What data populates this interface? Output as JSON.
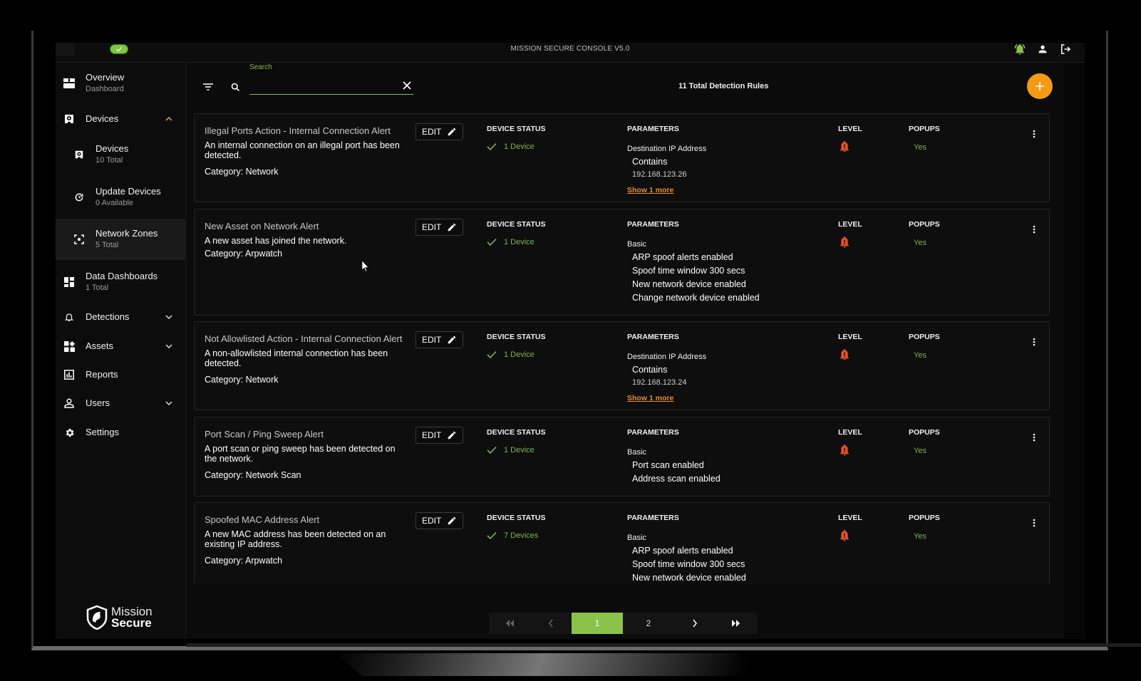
{
  "app": {
    "title": "MISSION SECURE CONSOLE V5.0",
    "status_indicator": "check-icon",
    "colors": {
      "accent_green": "#8bc34a",
      "accent_orange": "#f59a12",
      "alert_red": "#e8502a",
      "status_green": "#7fb34d"
    }
  },
  "topbar": {
    "icons": [
      "bell-ringing-icon",
      "user-icon",
      "logout-icon"
    ]
  },
  "sidebar": {
    "items": [
      {
        "label": "Overview",
        "sub": "Dashboard",
        "icon": "dashboard-icon"
      },
      {
        "label": "Devices",
        "sub": "",
        "icon": "device-icon",
        "expanded": true
      },
      {
        "label": "Devices",
        "sub": "10 Total",
        "icon": "device-icon"
      },
      {
        "label": "Update Devices",
        "sub": "0 Available",
        "icon": "update-icon"
      },
      {
        "label": "Network Zones",
        "sub": "5 Total",
        "icon": "zone-icon",
        "active": true
      },
      {
        "label": "Data Dashboards",
        "sub": "1 Total",
        "icon": "dashboard-icon"
      },
      {
        "label": "Detections",
        "sub": "",
        "icon": "bell-icon"
      },
      {
        "label": "Assets",
        "sub": "",
        "icon": "assets-icon"
      },
      {
        "label": "Reports",
        "sub": "",
        "icon": "report-icon"
      },
      {
        "label": "Users",
        "sub": "",
        "icon": "user-icon"
      },
      {
        "label": "Settings",
        "sub": "",
        "icon": "gear-icon"
      }
    ],
    "logo": {
      "line1": "Mission",
      "line2": "Secure"
    }
  },
  "toolbar": {
    "search_label": "Search",
    "search_value": "",
    "search_placeholder": "",
    "total_rules": "11 Total Detection Rules"
  },
  "columns": {
    "device_status": "DEVICE STATUS",
    "parameters": "PARAMETERS",
    "level": "LEVEL",
    "popups": "POPUPS",
    "edit": "EDIT"
  },
  "rules": [
    {
      "title": "Illegal Ports Action - Internal Connection Alert",
      "description": "An internal connection on an illegal port has been detected.",
      "category": "Category: Network",
      "device_status": "1 Device",
      "param_group": "Destination IP Address",
      "param_lines": [
        "Contains"
      ],
      "param_value": "192.168.123.26",
      "show_more": "Show 1 more",
      "level": "alert-high",
      "popups": "Yes"
    },
    {
      "title": "New Asset on Network Alert",
      "description": "A new asset has joined the network.",
      "category": "Category: Arpwatch",
      "device_status": "1 Device",
      "param_group": "Basic",
      "param_lines": [
        "ARP spoof alerts enabled",
        "Spoof time window 300 secs",
        "New network device enabled",
        "Change network device enabled"
      ],
      "param_value": "",
      "show_more": "",
      "level": "alert-high",
      "popups": "Yes"
    },
    {
      "title": "Not Allowlisted Action - Internal Connection Alert",
      "description": "A non-allowlisted internal connection has been detected.",
      "category": "Category: Network",
      "device_status": "1 Device",
      "param_group": "Destination IP Address",
      "param_lines": [
        "Contains"
      ],
      "param_value": "192.168.123.24",
      "show_more": "Show 1 more",
      "level": "alert-high",
      "popups": "Yes"
    },
    {
      "title": "Port Scan / Ping Sweep Alert",
      "description": "A port scan or ping sweep has been detected on the network.",
      "category": "Category: Network Scan",
      "device_status": "1 Device",
      "param_group": "Basic",
      "param_lines": [
        "Port scan enabled",
        "Address scan enabled"
      ],
      "param_value": "",
      "show_more": "",
      "level": "alert-high",
      "popups": "Yes"
    },
    {
      "title": "Spoofed MAC Address Alert",
      "description": "A new MAC address has been detected on an existing IP address.",
      "category": "Category: Arpwatch",
      "device_status": "7 Devices",
      "param_group": "Basic",
      "param_lines": [
        "ARP spoof alerts enabled",
        "Spoof time window 300 secs",
        "New network device enabled"
      ],
      "param_value": "",
      "show_more": "",
      "level": "alert-high",
      "popups": "Yes"
    }
  ],
  "pagination": {
    "first": "first-page-icon",
    "prev": "prev-page-icon",
    "pages": [
      "1",
      "2"
    ],
    "current": "1",
    "next": "next-page-icon",
    "last": "last-page-icon"
  }
}
